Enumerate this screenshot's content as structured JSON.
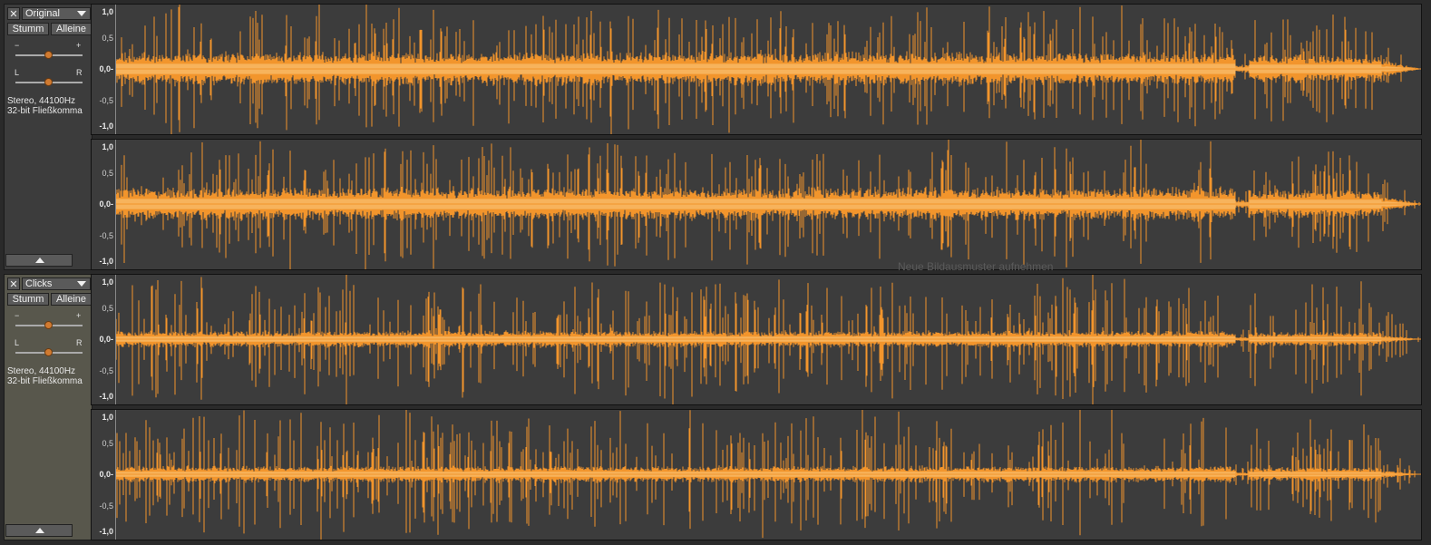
{
  "tracks": [
    {
      "name": "Original",
      "mute_label": "Stumm",
      "solo_label": "Alleine",
      "gain_minus": "−",
      "gain_plus": "+",
      "pan_left": "L",
      "pan_right": "R",
      "format_line1": "Stereo, 44100Hz",
      "format_line2": "32-bit Fließkomma",
      "gain_level": 0.5,
      "pan_level": 0.5
    },
    {
      "name": "Clicks",
      "mute_label": "Stumm",
      "solo_label": "Alleine",
      "gain_minus": "−",
      "gain_plus": "+",
      "pan_left": "L",
      "pan_right": "R",
      "format_line1": "Stereo, 44100Hz",
      "format_line2": "32-bit Fließkomma",
      "gain_level": 0.5,
      "pan_level": 0.5
    }
  ],
  "ruler": {
    "top": "1,0",
    "upper_mid": "0,5",
    "zero": "0,0-",
    "lower_mid": "-0,5",
    "bottom": "-1,0"
  },
  "ghost_hint": "Neue Bildausmuster aufnehmen",
  "colors": {
    "waveform": "#f2952c",
    "waveform_rms": "#f7b35c",
    "background": "#3c3c3c"
  },
  "icons": {
    "close": "close-icon",
    "menu": "chevron-down-icon",
    "collapse": "chevron-up-icon"
  }
}
